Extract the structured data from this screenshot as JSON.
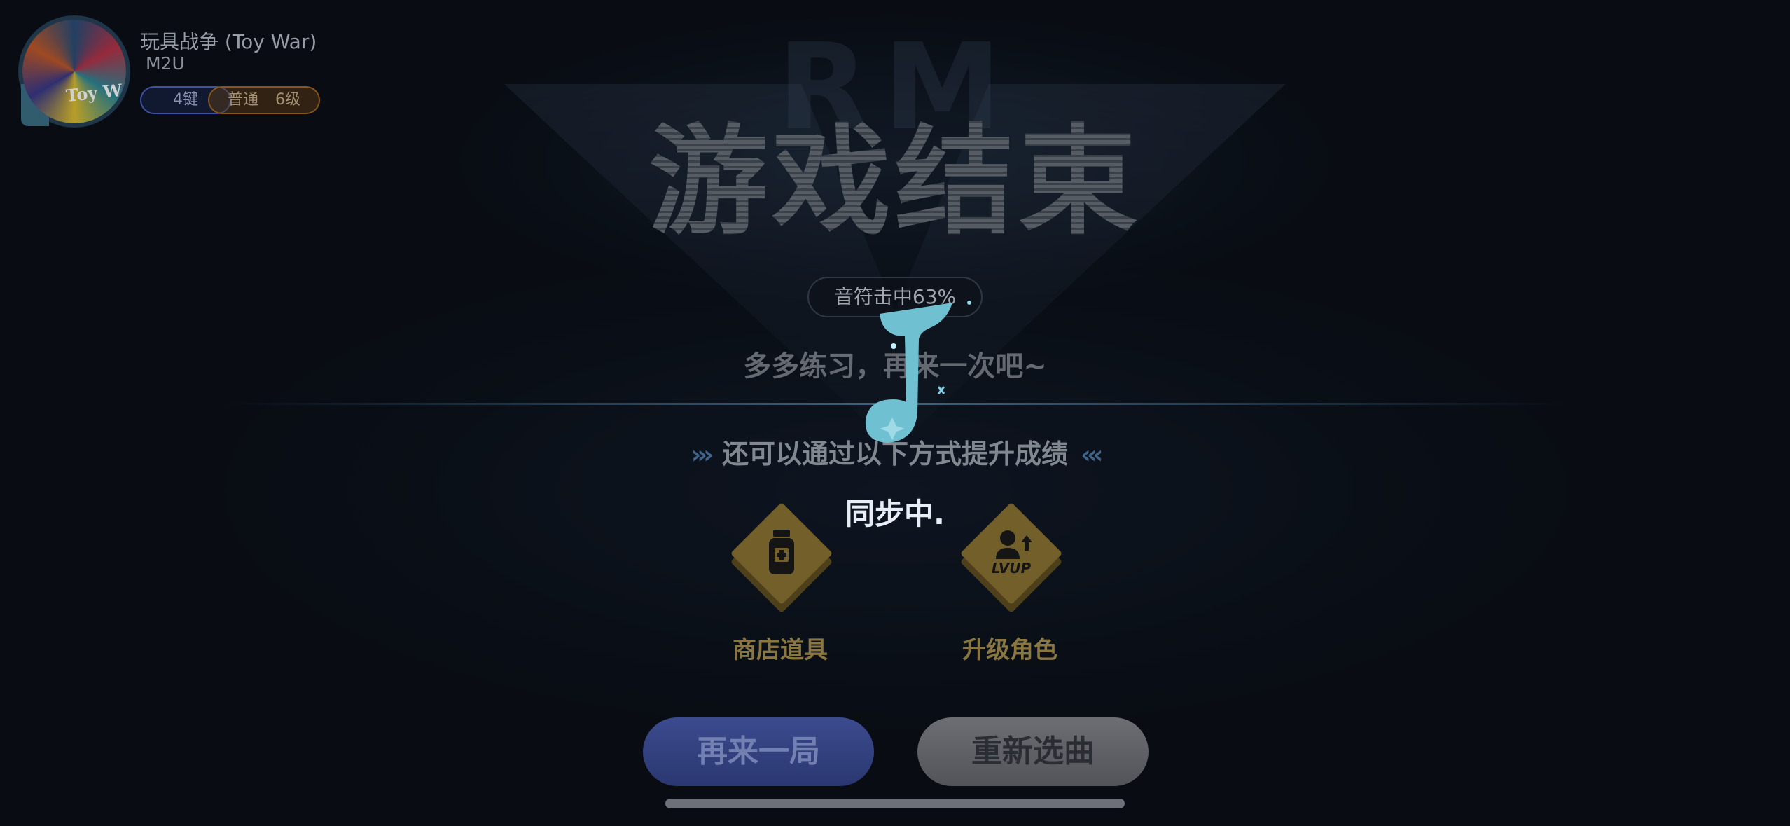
{
  "song": {
    "cover_text": "Toy W",
    "title": "玩具战争 (Toy War)",
    "artist": "M2U",
    "keys_badge": "4键",
    "difficulty": "普通",
    "level": "6级"
  },
  "result": {
    "headline": "游戏结束",
    "background_letters": "RM",
    "hit_rate": "音符击中63%",
    "message": "多多练习，再来一次吧~",
    "improve_hint": "还可以通过以下方式提升成绩",
    "chevrons_left": "›››",
    "chevrons_right": "‹‹‹"
  },
  "overlay": {
    "sync_status": "同步中."
  },
  "options": [
    {
      "label": "商店道具",
      "icon": "potion-icon"
    },
    {
      "label": "升级角色",
      "icon": "level-up-icon",
      "icon_text": "LVUP"
    }
  ],
  "buttons": {
    "again": "再来一局",
    "reselect": "重新选曲"
  },
  "colors": {
    "note_accent": "#6fc0d0",
    "option_gold": "#8b7432",
    "again_button": "#3c4b8f",
    "reselect_button": "#6c6e73"
  }
}
